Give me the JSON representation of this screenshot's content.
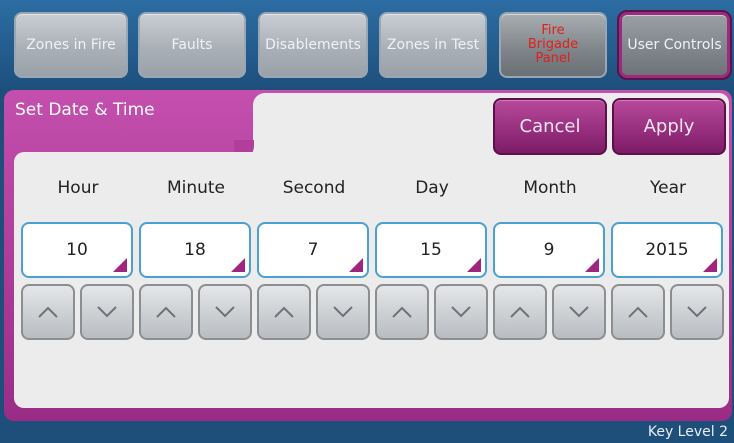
{
  "nav": {
    "zones_in_fire": "Zones in Fire",
    "faults": "Faults",
    "disablements": "Disablements",
    "zones_in_test": "Zones in Test",
    "fire_brigade_panel": "Fire Brigade Panel",
    "user_controls": "User Controls"
  },
  "panel": {
    "title": "Set Date & Time"
  },
  "actions": {
    "cancel": "Cancel",
    "apply": "Apply"
  },
  "fields": [
    {
      "label": "Hour",
      "value": "10"
    },
    {
      "label": "Minute",
      "value": "18"
    },
    {
      "label": "Second",
      "value": "7"
    },
    {
      "label": "Day",
      "value": "15"
    },
    {
      "label": "Month",
      "value": "9"
    },
    {
      "label": "Year",
      "value": "2015"
    }
  ],
  "status": {
    "key_level": "Key Level 2"
  },
  "colors": {
    "accent": "#a0257f",
    "nav_bg": "#1e4f7a",
    "fire_text": "#e0201a"
  },
  "icons": {
    "up": "chevron-up-icon",
    "down": "chevron-down-icon"
  }
}
